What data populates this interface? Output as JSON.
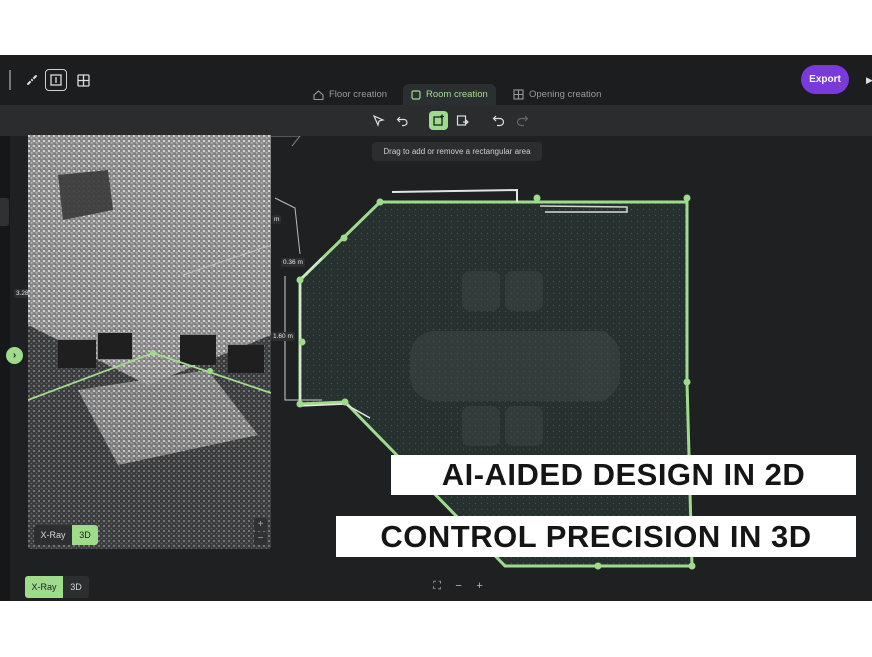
{
  "toolbar_top": {
    "icons": [
      "ruler-icon",
      "room-select-icon",
      "grid-icon"
    ],
    "export_label": "Export"
  },
  "tabs": [
    {
      "label": "Floor creation",
      "icon": "home-icon",
      "active": false
    },
    {
      "label": "Room creation",
      "icon": "room-icon",
      "active": true
    },
    {
      "label": "Opening creation",
      "icon": "window-icon",
      "active": false
    }
  ],
  "tools": [
    "pointer-icon",
    "undo-arrow-icon",
    "add-rect-area-icon",
    "remove-area-icon",
    "undo-icon",
    "redo-icon"
  ],
  "tooltip": "Drag to add or remove a rectangular area",
  "measurements": {
    "m1": "0.36 m",
    "m2": "1.60 m",
    "m3": "m",
    "left_edge": "3.28"
  },
  "panel3d_toggle": {
    "xray": "X-Ray",
    "view3d": "3D",
    "active": "3D"
  },
  "main_toggle": {
    "xray": "X-Ray",
    "view3d": "3D",
    "active": "X-Ray"
  },
  "bottom_zoom": {
    "fit": "⛶",
    "minus": "−",
    "plus": "+"
  },
  "captions": {
    "line1": "AI-AIDED DESIGN IN 2D",
    "line2": "CONTROL PRECISION IN 3D"
  },
  "colors": {
    "accent_green": "#9edc8c",
    "export_purple": "#7a39d9",
    "background": "#1e2022"
  }
}
